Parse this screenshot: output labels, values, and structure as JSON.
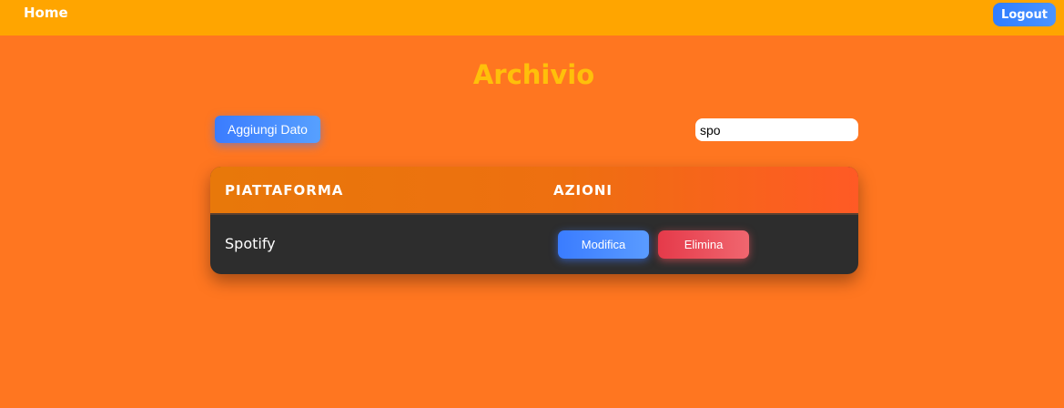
{
  "navbar": {
    "home_label": "Home",
    "logout_label": "Logout"
  },
  "page": {
    "title": "Archivio"
  },
  "toolbar": {
    "add_label": "Aggiungi Dato",
    "search_value": "spo"
  },
  "table": {
    "headers": [
      "PIATTAFORMA",
      "AZIONI"
    ],
    "rows": [
      {
        "platform": "Spotify",
        "edit_label": "Modifica",
        "delete_label": "Elimina"
      }
    ]
  },
  "colors": {
    "background": "#ff7620",
    "navbar": "#ffa500",
    "title": "#ffc00a",
    "primary_button": "#3a7cff",
    "danger_button": "#e53a4a",
    "table_body": "#2d2d2d"
  }
}
